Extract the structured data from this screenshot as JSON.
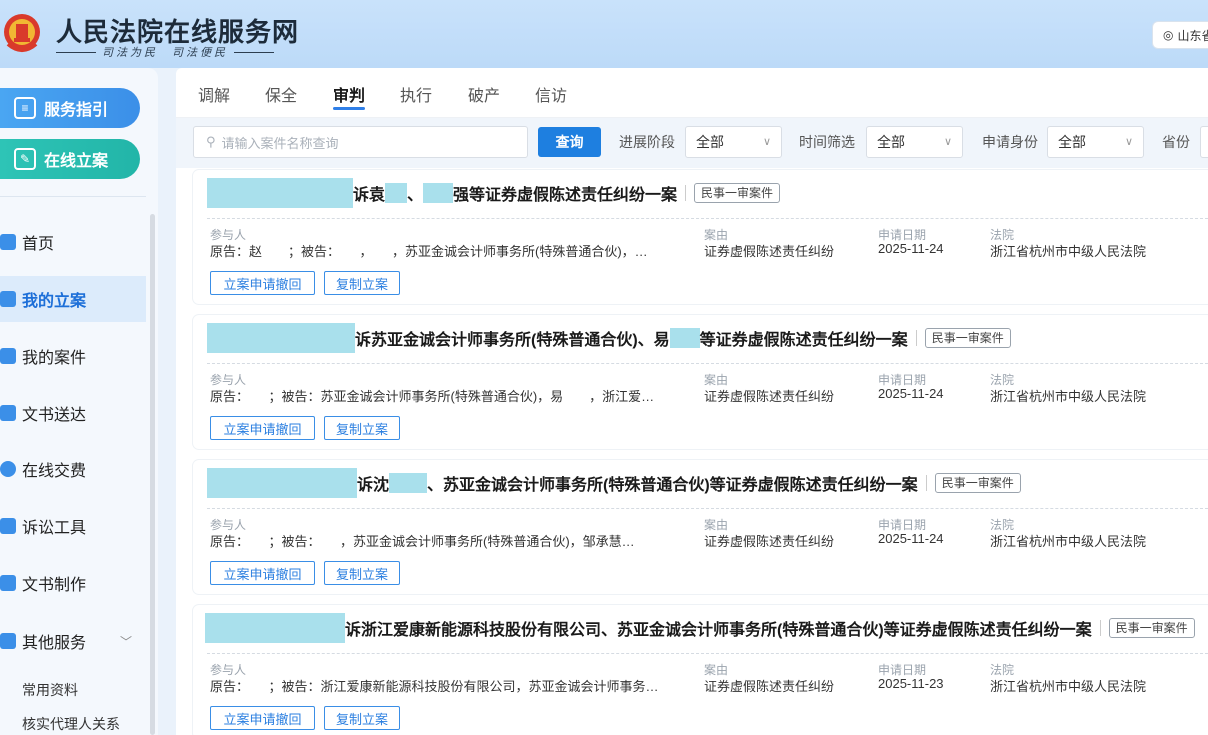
{
  "header": {
    "title": "人民法院在线服务网",
    "slogan": "司法为民　司法便民",
    "location": "山东省"
  },
  "sidebar": {
    "guide_label": "服务指引",
    "file_label": "在线立案",
    "nav": [
      {
        "label": "首页"
      },
      {
        "label": "我的立案"
      },
      {
        "label": "我的案件"
      },
      {
        "label": "文书送达"
      },
      {
        "label": "在线交费"
      },
      {
        "label": "诉讼工具"
      },
      {
        "label": "文书制作"
      },
      {
        "label": "其他服务"
      }
    ],
    "sub": [
      {
        "label": "常用资料"
      },
      {
        "label": "核实代理人关系"
      }
    ]
  },
  "tabs": [
    "调解",
    "保全",
    "审判",
    "执行",
    "破产",
    "信访"
  ],
  "active_tab": "审判",
  "filters": {
    "search_placeholder": "请输入案件名称查询",
    "search_button": "查询",
    "stage_label": "进展阶段",
    "stage_value": "全部",
    "time_label": "时间筛选",
    "time_value": "全部",
    "identity_label": "申请身份",
    "identity_value": "全部",
    "province_label": "省份"
  },
  "labels": {
    "party": "参与人",
    "cause": "案由",
    "date": "申请日期",
    "court": "法院",
    "withdraw": "立案申请撤回",
    "copy": "复制立案"
  },
  "cases": [
    {
      "title_a": "诉袁",
      "title_b": "、",
      "title_c": "强等证券虚假陈述责任纠纷一案",
      "tag": "民事一审案件",
      "parties": "原告：赵　　；被告：　　，　　，苏亚金诚会计师事务所(特殊普通合伙)，…",
      "cause": "证券虚假陈述责任纠纷",
      "date": "2025-11-24",
      "court": "浙江省杭州市中级人民法院"
    },
    {
      "title_a": "诉苏亚金诚会计师事务所(特殊普通合伙)、易",
      "title_b": "",
      "title_c": "等证券虚假陈述责任纠纷一案",
      "tag": "民事一审案件",
      "parties": "原告：　　；被告：苏亚金诚会计师事务所(特殊普通合伙)，易　　，浙江爱…",
      "cause": "证券虚假陈述责任纠纷",
      "date": "2025-11-24",
      "court": "浙江省杭州市中级人民法院"
    },
    {
      "title_a": "诉沈",
      "title_b": "",
      "title_c": "、苏亚金诚会计师事务所(特殊普通合伙)等证券虚假陈述责任纠纷一案",
      "tag": "民事一审案件",
      "parties": "原告：　　；被告：　　，苏亚金诚会计师事务所(特殊普通合伙)，邹承慧…",
      "cause": "证券虚假陈述责任纠纷",
      "date": "2025-11-24",
      "court": "浙江省杭州市中级人民法院"
    },
    {
      "title_a": "诉浙江爱康新能源科技股份有限公司、苏亚金诚会计师事务所(特殊普通合伙)等证券虚假陈述责任纠纷一案",
      "title_b": "",
      "title_c": "",
      "tag": "民事一审案件",
      "parties": "原告：　　；被告：浙江爱康新能源科技股份有限公司，苏亚金诚会计师事务…",
      "cause": "证券虚假陈述责任纠纷",
      "date": "2025-11-23",
      "court": "浙江省杭州市中级人民法院"
    }
  ],
  "colors": {
    "primary": "#1e7fe0",
    "teal": "#22b5a8",
    "redaction": "#a9e0ec"
  }
}
